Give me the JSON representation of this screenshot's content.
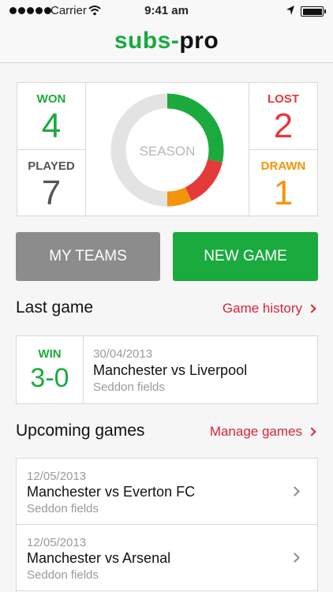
{
  "status_bar": {
    "carrier": "Carrier",
    "time": "9:41 am"
  },
  "app": {
    "logo_part1": "subs",
    "logo_dash": "-",
    "logo_part2": "pro"
  },
  "stats": {
    "won_label": "WON",
    "won_value": "4",
    "lost_label": "LOST",
    "lost_value": "2",
    "played_label": "PLAYED",
    "played_value": "7",
    "drawn_label": "DRAWN",
    "drawn_value": "1",
    "season_label": "SEASON"
  },
  "chart_data": {
    "type": "pie",
    "title": "SEASON",
    "segments": [
      {
        "name": "WON",
        "value": 4,
        "color": "#1aaa3e"
      },
      {
        "name": "LOST",
        "value": 2,
        "color": "#e43a3a"
      },
      {
        "name": "DRAWN",
        "value": 1,
        "color": "#f5930a"
      },
      {
        "name": "remaining",
        "value": 7,
        "color": "#e3e3e3"
      }
    ]
  },
  "buttons": {
    "my_teams": "MY TEAMS",
    "new_game": "NEW GAME"
  },
  "last_game": {
    "title": "Last game",
    "link": "Game history",
    "result": "WIN",
    "score": "3-0",
    "date": "30/04/2013",
    "teams": "Manchester vs Liverpool",
    "venue": "Seddon fields"
  },
  "upcoming": {
    "title": "Upcoming games",
    "link": "Manage games",
    "items": [
      {
        "date": "12/05/2013",
        "teams": "Manchester vs Everton FC",
        "venue": "Seddon fields"
      },
      {
        "date": "12/05/2013",
        "teams": "Manchester vs Arsenal",
        "venue": "Seddon fields"
      }
    ]
  }
}
